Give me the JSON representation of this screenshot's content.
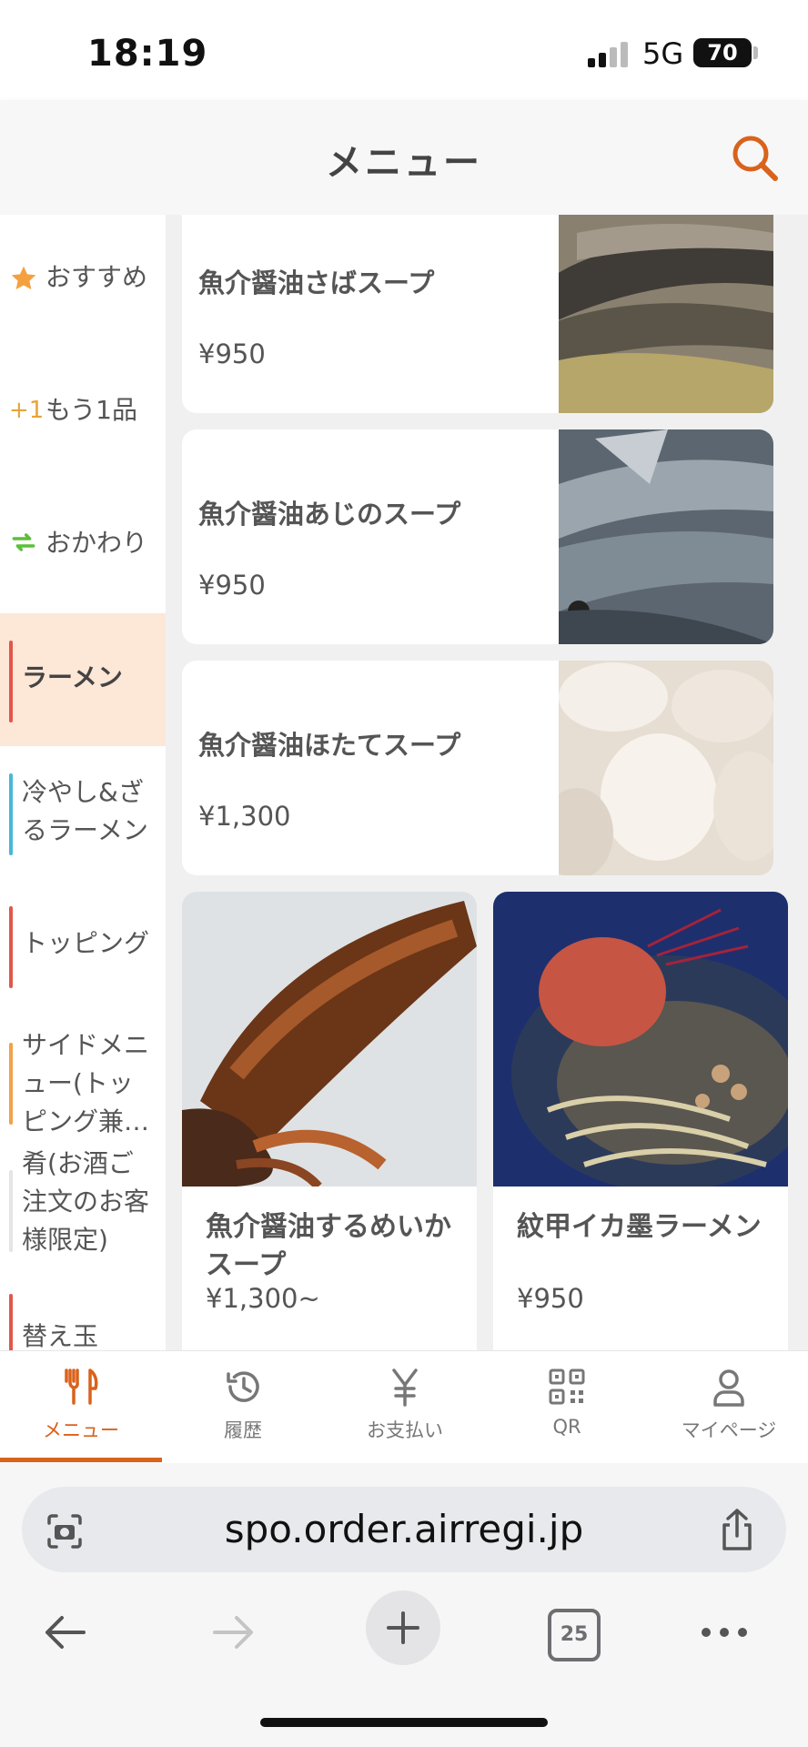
{
  "status_bar": {
    "time": "18:19",
    "network": "5G",
    "battery": "70"
  },
  "header": {
    "title": "メニュー"
  },
  "sidebar": {
    "items": [
      {
        "label": "おすすめ",
        "icon": "star-icon",
        "icon_color": "#f5a040"
      },
      {
        "label": "もう1品",
        "icon": "plus-one-icon",
        "icon_text": "+1",
        "icon_color": "#e8a33c"
      },
      {
        "label": "おかわり",
        "icon": "refresh-icon",
        "icon_color": "#5cbf3a"
      },
      {
        "label": "ラーメン",
        "active": true,
        "bar_color": "#e2564a"
      },
      {
        "label": "冷やし&ざるラーメン",
        "bar_color": "#49b7d8"
      },
      {
        "label": "トッピング",
        "bar_color": "#e2564a"
      },
      {
        "label": "サイドメニュー(トッピング兼…",
        "bar_color": "#f0a24a"
      },
      {
        "label": "肴(お酒ご注文のお客様限定)",
        "bar_color": "#e5e5e5"
      },
      {
        "label": "替え玉",
        "bar_color": "#e2564a"
      }
    ]
  },
  "menu": {
    "list_items": [
      {
        "name": "魚介醤油さばスープ",
        "price": "¥950"
      },
      {
        "name": "魚介醤油あじのスープ",
        "price": "¥950"
      },
      {
        "name": "魚介醤油ほたてスープ",
        "price": "¥1,300"
      }
    ],
    "grid_items": [
      {
        "name": "魚介醤油するめいかスープ",
        "price": "¥1,300~"
      },
      {
        "name": "紋甲イカ墨ラーメン",
        "price": "¥950"
      }
    ]
  },
  "bottom_nav": {
    "items": [
      {
        "label": "メニュー",
        "icon": "fork-knife-icon",
        "active": true
      },
      {
        "label": "履歴",
        "icon": "history-icon"
      },
      {
        "label": "お支払い",
        "icon": "yen-icon"
      },
      {
        "label": "QR",
        "icon": "qr-code-icon"
      },
      {
        "label": "マイページ",
        "icon": "person-icon"
      }
    ]
  },
  "browser": {
    "url": "spo.order.airregi.jp",
    "tab_count": "25"
  },
  "colors": {
    "accent": "#d9621c",
    "active_sidebar_bg": "#fde7d7"
  }
}
